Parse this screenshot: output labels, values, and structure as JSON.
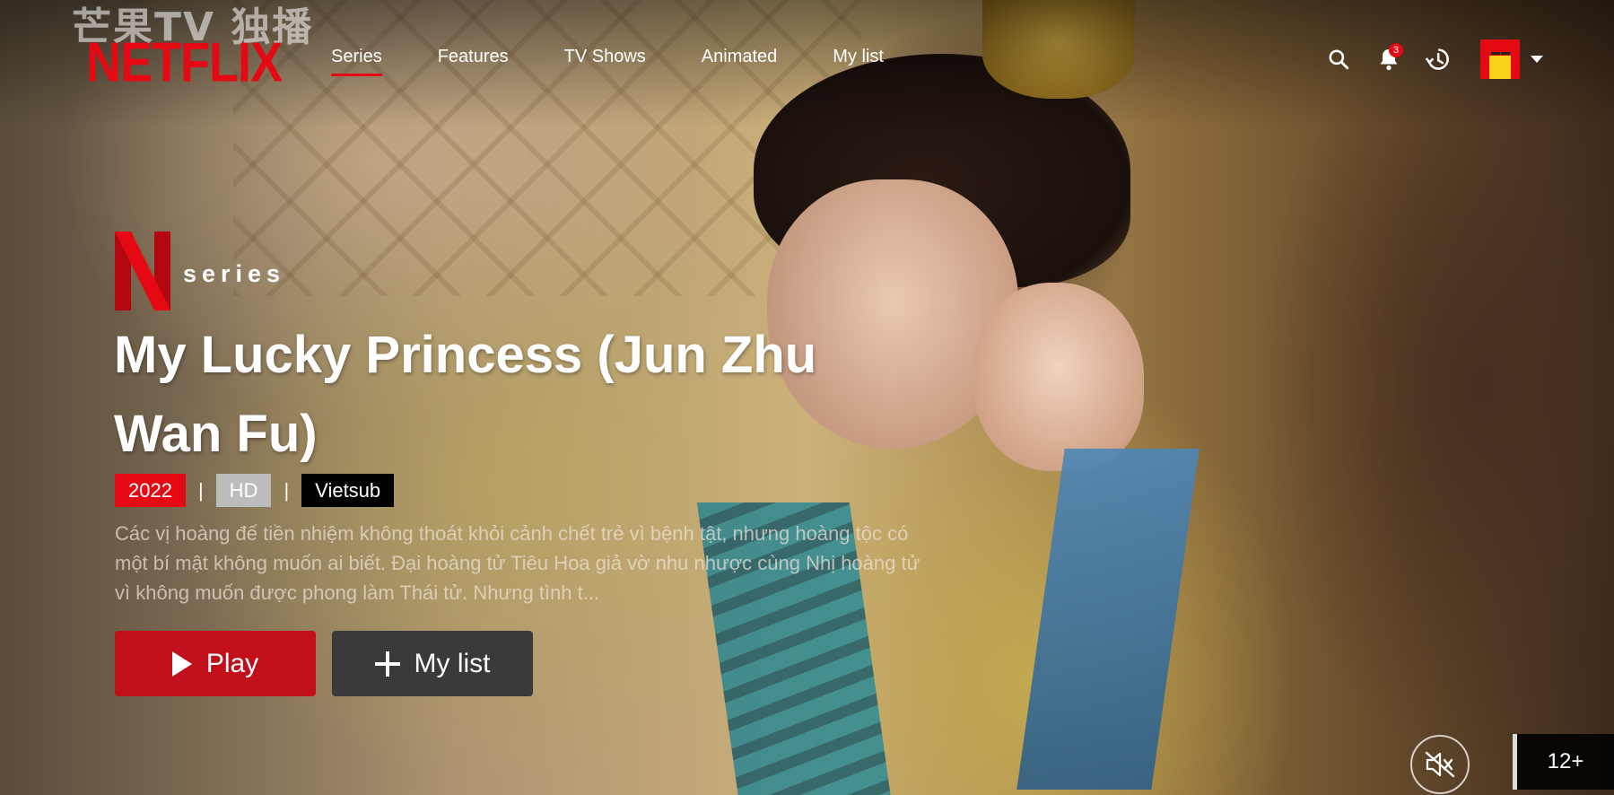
{
  "watermark": "芒果TV 独播",
  "brand": {
    "logo": "NETFLIX",
    "accent": "#e50914"
  },
  "nav": {
    "items": [
      {
        "label": "Series",
        "active": true
      },
      {
        "label": "Features",
        "active": false
      },
      {
        "label": "TV Shows",
        "active": false
      },
      {
        "label": "Animated",
        "active": false
      },
      {
        "label": "My list",
        "active": false
      }
    ]
  },
  "header": {
    "search_icon": "search-icon",
    "notifications_icon": "bell-icon",
    "notification_count": "3",
    "history_icon": "history-icon",
    "avatar": "profile-avatar",
    "menu_icon": "caret-down-icon"
  },
  "billboard": {
    "series_label": "series",
    "title": "My Lucky Princess (Jun Zhu Wan Fu)",
    "year": "2022",
    "quality": "HD",
    "subtitle": "Vietsub",
    "separator": "|",
    "description": "Các vị hoàng đế tiền nhiệm không thoát khỏi cảnh chết trẻ vì bệnh tật, nhưng hoàng tộc có một bí mật không muốn ai biết. Đại hoàng tử Tiêu Hoa giả vờ nhu nhược cùng Nhị hoàng tử vì không muốn được phong làm Thái tử. Nhưng tình t...",
    "play_label": "Play",
    "mylist_label": "My list"
  },
  "player": {
    "mute_icon": "volume-muted-icon",
    "age_rating": "12+"
  }
}
